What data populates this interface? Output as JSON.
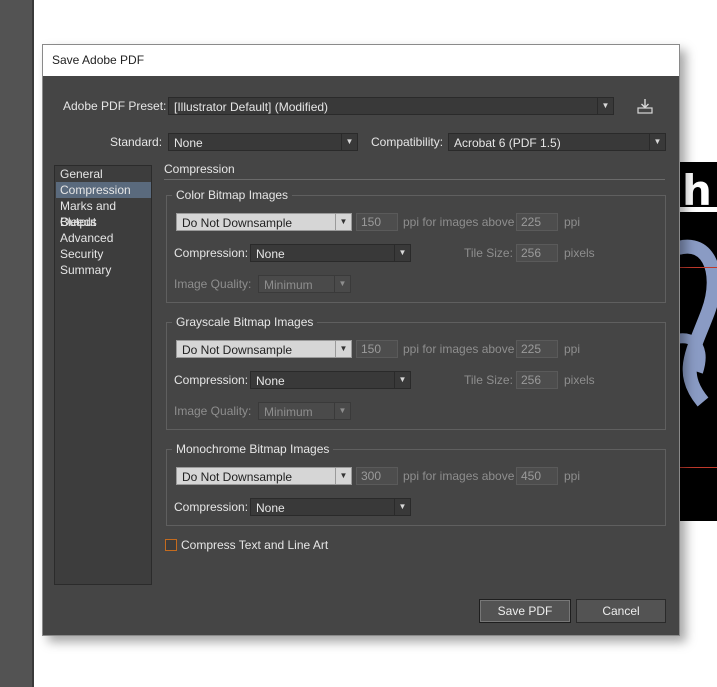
{
  "dialog": {
    "title": "Save Adobe PDF"
  },
  "preset": {
    "label": "Adobe PDF Preset:",
    "value": "[Illustrator Default] (Modified)"
  },
  "standard": {
    "label": "Standard:",
    "value": "None"
  },
  "compatibility": {
    "label": "Compatibility:",
    "value": "Acrobat 6 (PDF 1.5)"
  },
  "sidebar": {
    "items": [
      {
        "label": "General"
      },
      {
        "label": "Compression"
      },
      {
        "label": "Marks and Bleeds"
      },
      {
        "label": "Output"
      },
      {
        "label": "Advanced"
      },
      {
        "label": "Security"
      },
      {
        "label": "Summary"
      }
    ]
  },
  "section_title": "Compression",
  "color": {
    "title": "Color Bitmap Images",
    "downsample": "Do Not Downsample",
    "ppi": "150",
    "above_label": "ppi for images above",
    "above_ppi": "225",
    "ppi_unit": "ppi",
    "compression_label": "Compression:",
    "compression": "None",
    "tile_label": "Tile Size:",
    "tile": "256",
    "tile_unit": "pixels",
    "quality_label": "Image Quality:",
    "quality": "Minimum"
  },
  "grayscale": {
    "title": "Grayscale Bitmap Images",
    "downsample": "Do Not Downsample",
    "ppi": "150",
    "above_label": "ppi for images above",
    "above_ppi": "225",
    "ppi_unit": "ppi",
    "compression_label": "Compression:",
    "compression": "None",
    "tile_label": "Tile Size:",
    "tile": "256",
    "tile_unit": "pixels",
    "quality_label": "Image Quality:",
    "quality": "Minimum"
  },
  "monochrome": {
    "title": "Monochrome Bitmap Images",
    "downsample": "Do Not Downsample",
    "ppi": "300",
    "above_label": "ppi for images above",
    "above_ppi": "450",
    "ppi_unit": "ppi",
    "compression_label": "Compression:",
    "compression": "None"
  },
  "compress_text": {
    "label": "Compress Text and Line Art",
    "checked": false
  },
  "buttons": {
    "save": "Save PDF",
    "cancel": "Cancel"
  },
  "colors": {
    "accent": "#5a6a7d",
    "checkbox_border": "#c46b1e"
  }
}
